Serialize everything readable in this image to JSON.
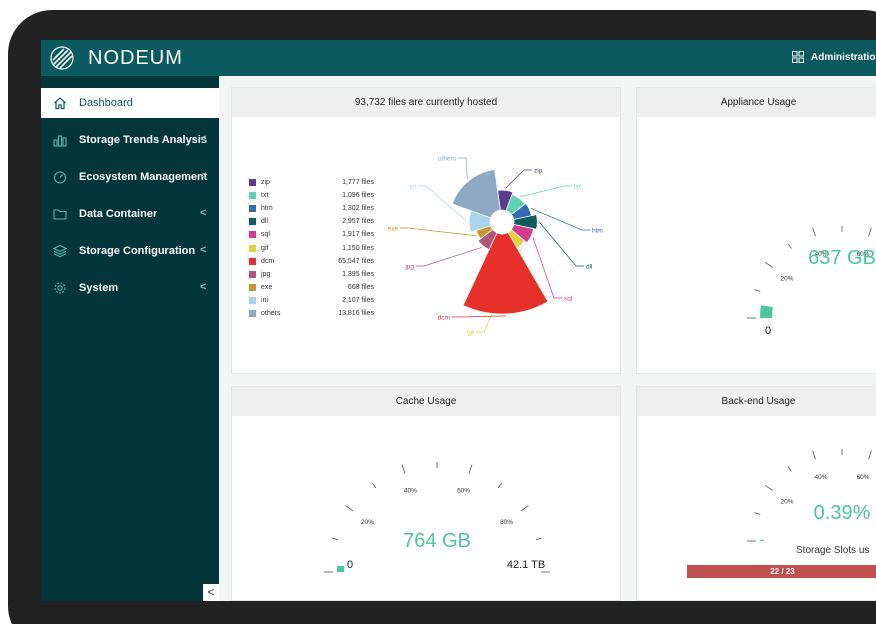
{
  "app": {
    "brand": "NODEUM",
    "admin_label": "Administration"
  },
  "sidebar": {
    "items": [
      {
        "label": "Dashboard",
        "icon": "home-icon",
        "active": true
      },
      {
        "label": "Storage Trends Analysis",
        "icon": "bar-chart-icon"
      },
      {
        "label": "Ecosystem Management",
        "icon": "gauge-icon"
      },
      {
        "label": "Data Container",
        "icon": "folder-icon"
      },
      {
        "label": "Storage Configuration",
        "icon": "layers-icon"
      },
      {
        "label": "System",
        "icon": "gear-icon"
      }
    ],
    "collapse_glyph": "<"
  },
  "files_card": {
    "title": "93,732 files are currently hosted",
    "legend": [
      {
        "name": "zip",
        "count": "1,777 files",
        "color": "#5a3d91"
      },
      {
        "name": "txt",
        "count": "1,096 files",
        "color": "#5fd0b0"
      },
      {
        "name": "htm",
        "count": "1,302 files",
        "color": "#2f6cb3"
      },
      {
        "name": "dll",
        "count": "2,957 files",
        "color": "#0e5c5c"
      },
      {
        "name": "sql",
        "count": "1,917 files",
        "color": "#d63a8c"
      },
      {
        "name": "gif",
        "count": "1,150 files",
        "color": "#e3d23a"
      },
      {
        "name": "dcm",
        "count": "65,547 files",
        "color": "#e8302a"
      },
      {
        "name": "jpg",
        "count": "1,395 files",
        "color": "#b0577a"
      },
      {
        "name": "exe",
        "count": "668 files",
        "color": "#c89a2d"
      },
      {
        "name": "ini",
        "count": "2,107 files",
        "color": "#a9d4ee"
      },
      {
        "name": "others",
        "count": "13,816 files",
        "color": "#8ea9c4"
      }
    ]
  },
  "chart_data": {
    "type": "pie",
    "title": "93,732 files are currently hosted",
    "categories": [
      "zip",
      "txt",
      "htm",
      "dll",
      "sql",
      "gif",
      "dcm",
      "jpg",
      "exe",
      "ini",
      "others"
    ],
    "values": [
      1777,
      1096,
      1302,
      2957,
      1917,
      1150,
      65547,
      1395,
      668,
      2107,
      13816
    ],
    "colors": [
      "#5a3d91",
      "#5fd0b0",
      "#2f6cb3",
      "#0e5c5c",
      "#d63a8c",
      "#e3d23a",
      "#e8302a",
      "#b0577a",
      "#c89a2d",
      "#a9d4ee",
      "#8ea9c4"
    ]
  },
  "appliance_card": {
    "title": "Appliance Usage",
    "value": "637 GB",
    "min": "0",
    "ticks": [
      "20%",
      "40%",
      "60%"
    ],
    "fill_fraction": 0.05
  },
  "cache_card": {
    "title": "Cache Usage",
    "value": "764 GB",
    "min": "0",
    "max": "42.1 TB",
    "ticks": [
      "20%",
      "40%",
      "60%",
      "80%"
    ],
    "fill_fraction": 0.02
  },
  "backend_card": {
    "title": "Back-end Usage",
    "value": "0.39%",
    "ticks": [
      "20%",
      "40%",
      "60%"
    ],
    "fill_fraction": 0.004,
    "slots_label": "Storage Slots us",
    "slots_value": "22 / 23",
    "slots_fraction": 0.957
  }
}
